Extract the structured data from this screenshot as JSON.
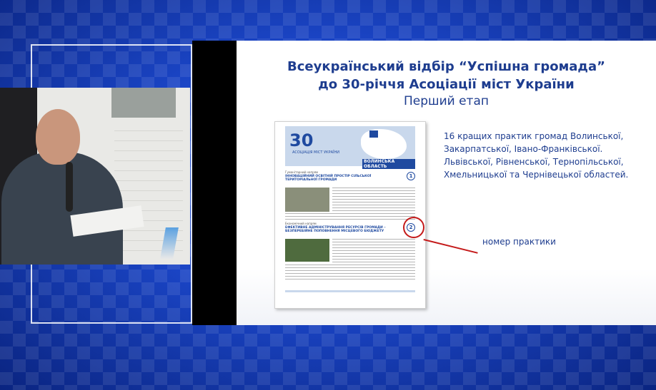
{
  "slide": {
    "title_line1": "Всеукраїнський відбір “Успішна громада”",
    "title_line2": "до 30-річчя Асоціації міст України",
    "subtitle": "Перший етап",
    "description": "16 кращих практик громад Волинської, Закарпатської, Івано-Франківської. Львівської, Рівненської, Тернопільської, Хмельницької та Чернівецької областей.",
    "annotation": "номер практики"
  },
  "document": {
    "logo_number": "30",
    "logo_caption": "АСОЦІАЦІЯ МІСТ УКРАЇНИ",
    "region": "ВОЛИНСЬКА ОБЛАСТЬ",
    "practice1": {
      "tag": "Гуманітарний напрям",
      "heading": "ІННОВАЦІЙНИЙ ОСВІТНІЙ ПРОСТІР СІЛЬСЬКОЇ ТЕРИТОРІАЛЬНОЇ ГРОМАДИ",
      "number": "1"
    },
    "practice2": {
      "tag": "Економічний напрям",
      "heading": "ЕФЕКТИВНЕ АДМІНІСТРУВАННЯ РЕСУРСІВ ГРОМАДИ – БЕЗПЕРЕБІЙНЕ ПОПОВНЕННЯ МІСЦЕВОГО БЮДЖЕТУ",
      "number": "2"
    }
  },
  "colors": {
    "title_blue": "#1e3d8f",
    "highlight_red": "#c41a1a",
    "background_blue": "#1a44c4"
  }
}
